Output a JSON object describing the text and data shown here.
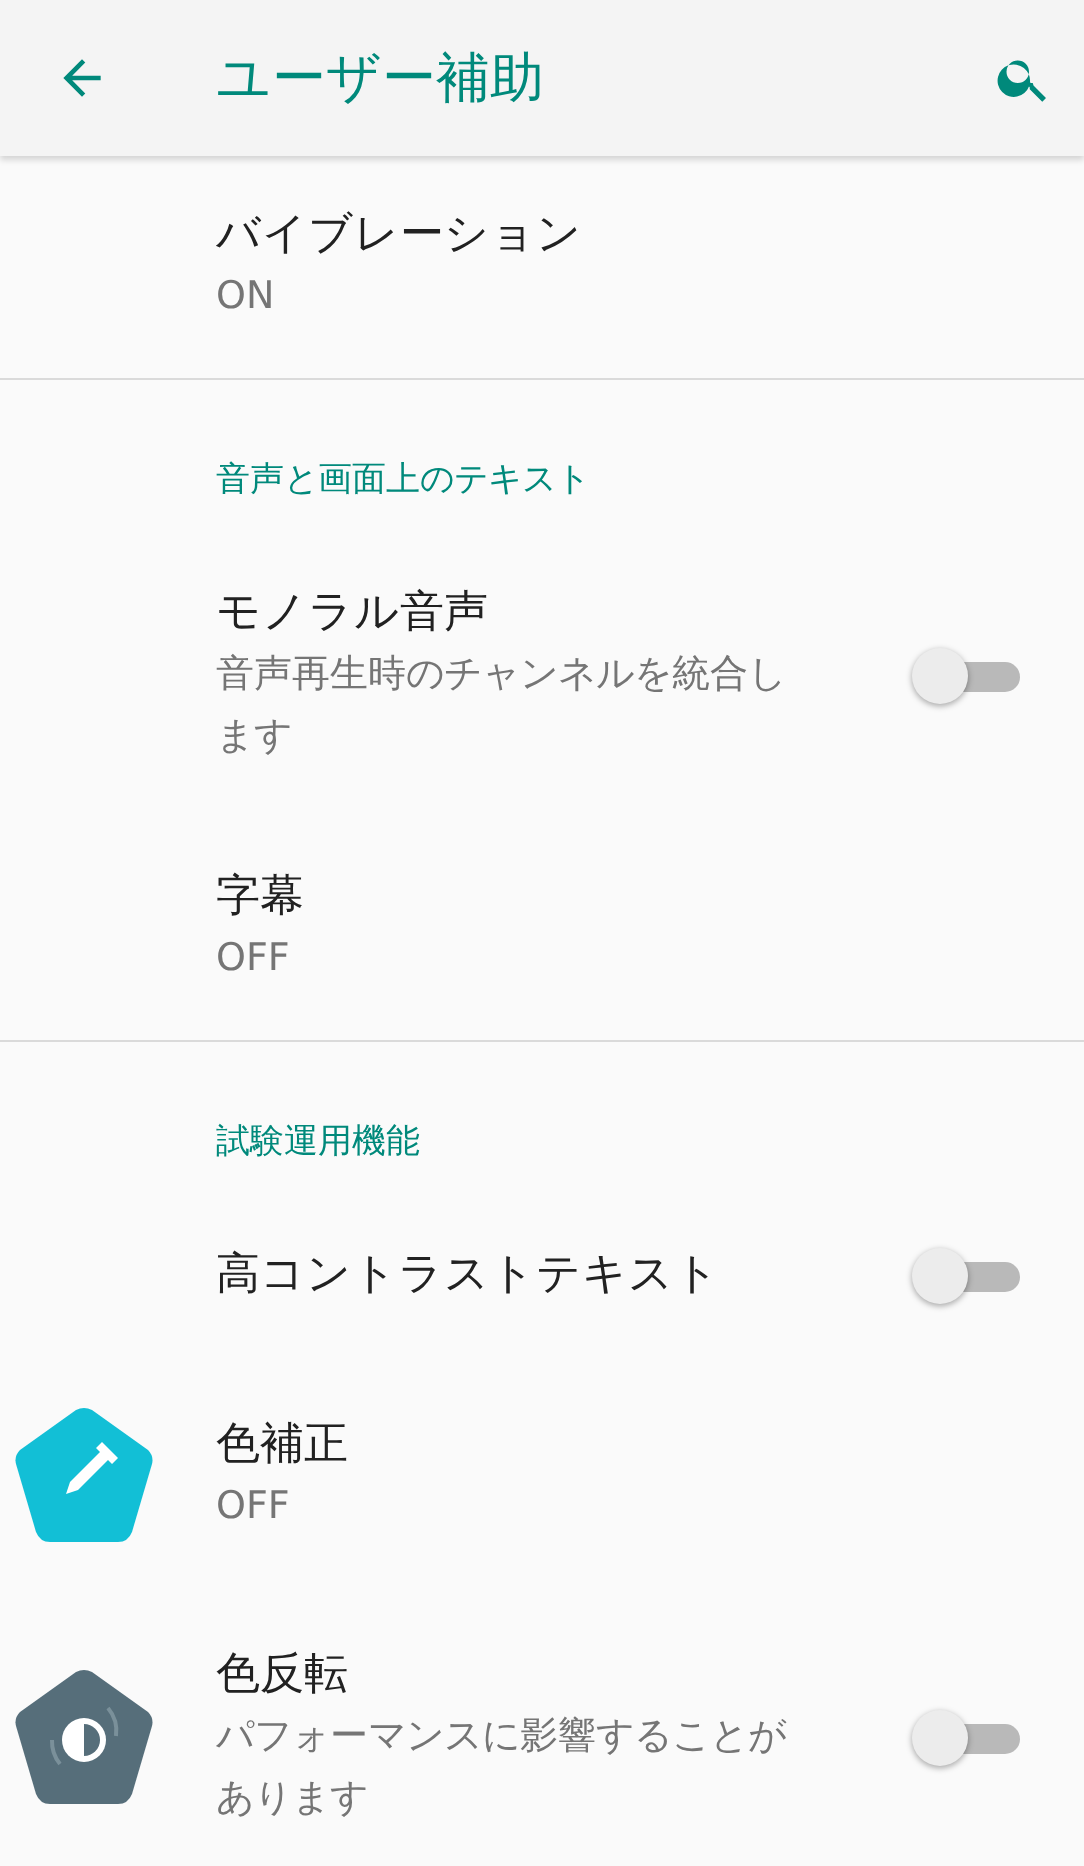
{
  "app_bar": {
    "title": "ユーザー補助"
  },
  "sections": [
    {
      "items": [
        {
          "kind": "text",
          "title": "バイブレーション",
          "summary": "ON"
        }
      ]
    },
    {
      "header": "音声と画面上のテキスト",
      "items": [
        {
          "kind": "switch",
          "title": "モノラル音声",
          "summary": "音声再生時のチャンネルを統合します",
          "on": false
        },
        {
          "kind": "text",
          "title": "字幕",
          "summary": "OFF"
        }
      ]
    },
    {
      "header": "試験運用機能",
      "items": [
        {
          "kind": "switch",
          "title": "高コントラストテキスト",
          "on": false
        },
        {
          "kind": "color_correction",
          "title": "色補正",
          "summary": "OFF"
        },
        {
          "kind": "color_inversion",
          "title": "色反転",
          "summary": "パフォーマンスに影響することがあります",
          "on": false
        }
      ]
    }
  ]
}
